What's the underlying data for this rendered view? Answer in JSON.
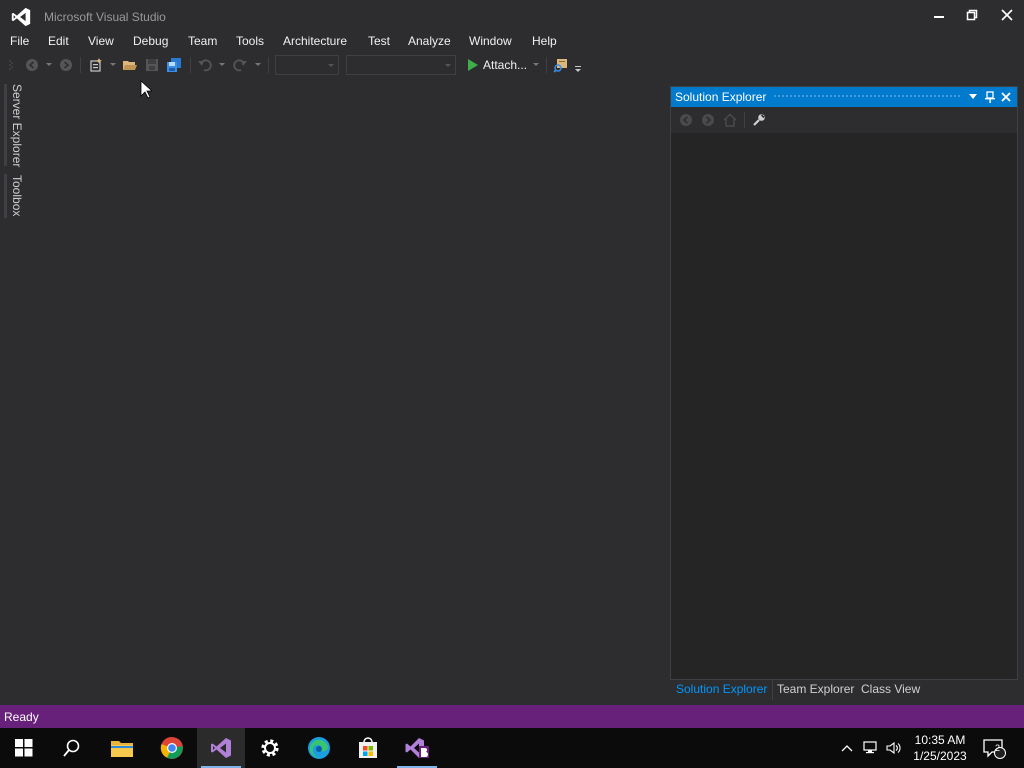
{
  "window": {
    "title": "Microsoft Visual Studio",
    "controls": [
      "minimize",
      "restore",
      "close"
    ]
  },
  "menu": [
    "File",
    "Edit",
    "View",
    "Debug",
    "Team",
    "Tools",
    "Architecture",
    "Test",
    "Analyze",
    "Window",
    "Help"
  ],
  "toolbar": {
    "icons": [
      "back-icon",
      "forward-icon",
      "new-project-icon",
      "open-file-icon",
      "save-icon",
      "save-all-icon",
      "undo-icon",
      "redo-icon",
      "start-icon",
      "find-in-files-icon"
    ],
    "solution_config": "",
    "solution_platform": "",
    "attach_label": "Attach..."
  },
  "left_rail": {
    "tabs": [
      "Server Explorer",
      "Toolbox"
    ]
  },
  "solution_explorer": {
    "title": "Solution Explorer",
    "toolbar_icons": [
      "back-icon",
      "forward-icon",
      "home-icon",
      "properties-wrench-icon"
    ],
    "bottom_tabs": [
      "Solution Explorer",
      "Team Explorer",
      "Class View"
    ],
    "active_tab": "Solution Explorer"
  },
  "statusbar": {
    "text": "Ready"
  },
  "taskbar": {
    "apps": [
      "start-icon",
      "search-icon",
      "file-explorer-icon",
      "chrome-icon",
      "visual-studio-icon",
      "settings-icon",
      "edge-icon",
      "store-icon",
      "vs-blend-icon"
    ],
    "active_app": "visual-studio-icon",
    "tray_icons": [
      "chevron-up-icon",
      "network-icon",
      "volume-icon",
      "notification-icon"
    ],
    "time": "10:35 AM",
    "date": "1/25/2023",
    "notification_count": "2"
  },
  "colors": {
    "accent_blue": "#007acc",
    "status_purple": "#68217a",
    "background": "#2d2d30",
    "panel": "#252526"
  }
}
